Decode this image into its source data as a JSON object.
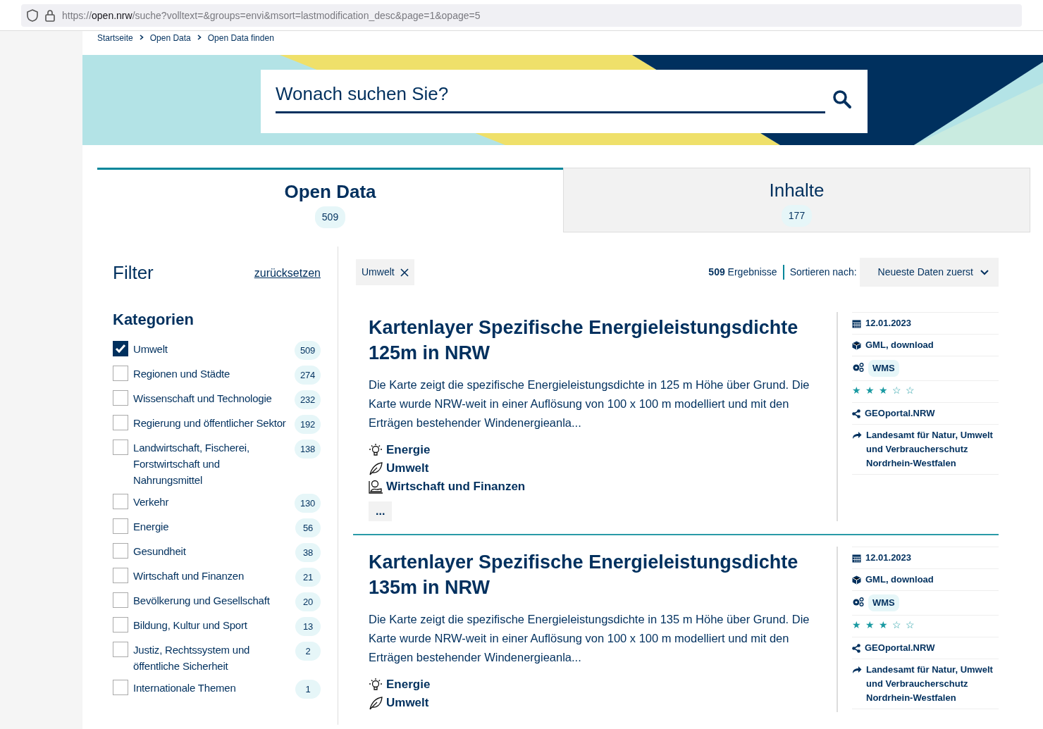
{
  "browser": {
    "url": {
      "scheme": "https://",
      "host": "open.nrw",
      "path": "/suche?volltext=&groups=envi&msort=lastmodification_desc&page=1&opage=5"
    }
  },
  "breadcrumb": [
    {
      "label": "Startseite"
    },
    {
      "label": "Open Data"
    },
    {
      "label": "Open Data finden"
    }
  ],
  "search": {
    "placeholder": "Wonach suchen Sie?"
  },
  "tabs": [
    {
      "label": "Open Data",
      "count": "509",
      "selected": true
    },
    {
      "label": "Inhalte",
      "count": "177",
      "selected": false
    }
  ],
  "filter": {
    "title": "Filter",
    "reset": "zurücksetzen",
    "section": "Kategorien",
    "categories": [
      {
        "label": "Umwelt",
        "count": "509",
        "checked": true
      },
      {
        "label": "Regionen und Städte",
        "count": "274",
        "checked": false
      },
      {
        "label": "Wissenschaft und Technologie",
        "count": "232",
        "checked": false
      },
      {
        "label": "Regierung und öffentlicher Sektor",
        "count": "192",
        "checked": false
      },
      {
        "label": "Landwirtschaft, Fischerei, Forstwirtschaft und Nahrungsmittel",
        "count": "138",
        "checked": false
      },
      {
        "label": "Verkehr",
        "count": "130",
        "checked": false
      },
      {
        "label": "Energie",
        "count": "56",
        "checked": false
      },
      {
        "label": "Gesundheit",
        "count": "38",
        "checked": false
      },
      {
        "label": "Wirtschaft und Finanzen",
        "count": "21",
        "checked": false
      },
      {
        "label": "Bevölkerung und Gesellschaft",
        "count": "20",
        "checked": false
      },
      {
        "label": "Bildung, Kultur und Sport",
        "count": "13",
        "checked": false
      },
      {
        "label": "Justiz, Rechtssystem und öffentliche Sicherheit",
        "count": "2",
        "checked": false
      },
      {
        "label": "Internationale Themen",
        "count": "1",
        "checked": false
      }
    ]
  },
  "active_filters": [
    {
      "label": "Umwelt"
    }
  ],
  "results_bar": {
    "count": "509",
    "count_label": "Ergebnisse",
    "sort_label": "Sortieren nach:",
    "sort_value": "Neueste Daten zuerst"
  },
  "results": [
    {
      "title": "Kartenlayer Spezifische Energieleistungsdichte 125m in NRW",
      "description": "Die Karte zeigt die spezifische Energieleistungsdichte in 125 m Höhe über Grund. Die Karte wurde NRW-weit in einer Auflösung von 100 x 100 m modelliert und mit den Erträgen bestehender Windenergieanla...",
      "groups": [
        {
          "kind": "energy",
          "label": "Energie"
        },
        {
          "kind": "environment",
          "label": "Umwelt"
        },
        {
          "kind": "economy",
          "label": "Wirtschaft und Finanzen"
        }
      ],
      "more": "...",
      "meta": {
        "date": "12.01.2023",
        "formats": "GML, download",
        "service": "WMS",
        "stars": 3,
        "source": "GEOportal.NRW",
        "publisher": "Landesamt für Natur, Umwelt und Verbraucherschutz Nordrhein-Westfalen"
      }
    },
    {
      "title": "Kartenlayer Spezifische Energieleistungsdichte 135m in NRW",
      "description": "Die Karte zeigt die spezifische Energieleistungsdichte in 135 m Höhe über Grund. Die Karte wurde NRW-weit in einer Auflösung von 100 x 100 m modelliert und mit den Erträgen bestehender Windenergieanla...",
      "groups": [
        {
          "kind": "energy",
          "label": "Energie"
        },
        {
          "kind": "environment",
          "label": "Umwelt"
        }
      ],
      "meta": {
        "date": "12.01.2023",
        "formats": "GML, download",
        "service": "WMS",
        "stars": 3,
        "source": "GEOportal.NRW",
        "publisher": "Landesamt für Natur, Umwelt und Verbraucherschutz Nordrhein-Westfalen"
      }
    }
  ]
}
